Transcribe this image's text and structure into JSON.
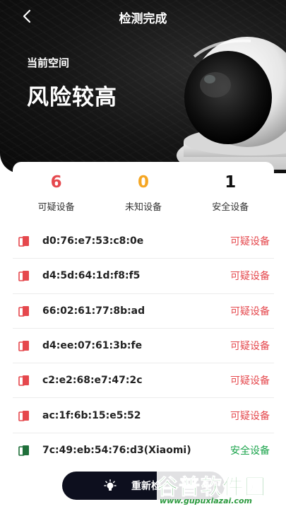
{
  "header": {
    "title": "检测完成",
    "back_icon": "chevron-left-icon"
  },
  "hero": {
    "space_label": "当前空间",
    "risk_level": "风险较高"
  },
  "stats": [
    {
      "value": "6",
      "label": "可疑设备",
      "color": "#e5484d"
    },
    {
      "value": "0",
      "label": "未知设备",
      "color": "#f5a623"
    },
    {
      "value": "1",
      "label": "安全设备",
      "color": "#111111"
    }
  ],
  "devices": [
    {
      "mac": "d0:76:e7:53:c8:0e",
      "status": "可疑设备",
      "kind": "suspicious"
    },
    {
      "mac": "d4:5d:64:1d:f8:f5",
      "status": "可疑设备",
      "kind": "suspicious"
    },
    {
      "mac": "66:02:61:77:8b:ad",
      "status": "可疑设备",
      "kind": "suspicious"
    },
    {
      "mac": "d4:ee:07:61:3b:fe",
      "status": "可疑设备",
      "kind": "suspicious"
    },
    {
      "mac": "c2:e2:68:e7:47:2c",
      "status": "可疑设备",
      "kind": "suspicious"
    },
    {
      "mac": "ac:1f:6b:15:e5:52",
      "status": "可疑设备",
      "kind": "suspicious"
    },
    {
      "mac": "7c:49:eb:54:76:d3(Xiaomi)",
      "status": "安全设备",
      "kind": "safe"
    }
  ],
  "rescan_button": {
    "label": "重新检"
  },
  "watermark": {
    "brand": "谷普软件园",
    "url": "www.gupuxiazai.com"
  },
  "colors": {
    "suspicious": "#e5484d",
    "unknown": "#f5a623",
    "safe": "#19a34a",
    "hero_bg": "#141414",
    "button_bg": "#0d0f1e"
  }
}
